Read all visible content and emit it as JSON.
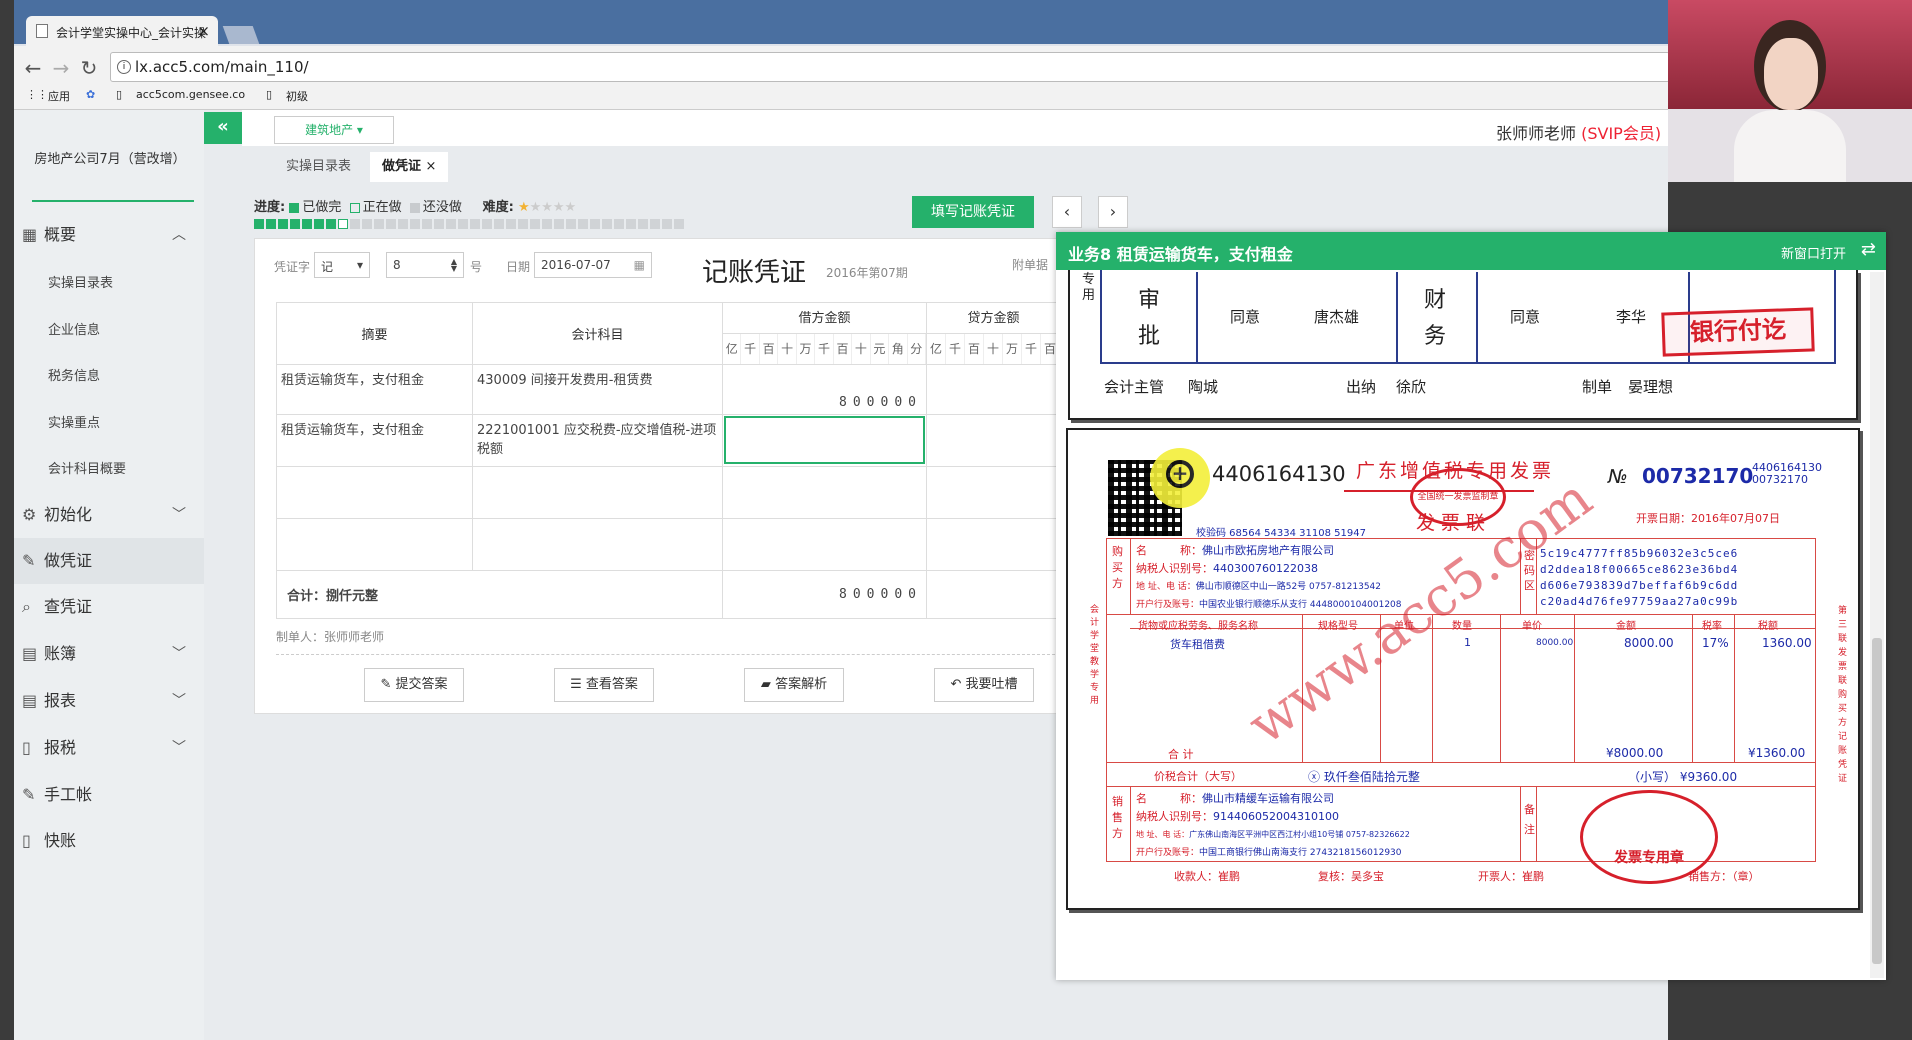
{
  "browser": {
    "tab_title": "会计学堂实操中心_会计实操",
    "url": "lx.acc5.com/main_110/",
    "bookmarks": [
      "应用",
      "acc5com.gensee.co",
      "初级"
    ]
  },
  "header": {
    "collapse_icon": "«",
    "category": "建筑地产",
    "teacher": "张师师老师",
    "vip": "(SVIP会员)"
  },
  "sidebar": {
    "org": "房地产公司7月（营改增）",
    "items": [
      {
        "label": "概要",
        "icon": "grid-icon",
        "expanded": true
      },
      {
        "label": "初始化",
        "icon": "gear-icon"
      },
      {
        "label": "做凭证",
        "icon": "pen-icon",
        "active": true
      },
      {
        "label": "查凭证",
        "icon": "search-icon"
      },
      {
        "label": "账簿",
        "icon": "book-icon"
      },
      {
        "label": "报表",
        "icon": "report-icon"
      },
      {
        "label": "报税",
        "icon": "file-icon"
      },
      {
        "label": "手工帐",
        "icon": "pen-icon"
      },
      {
        "label": "快账",
        "icon": "file-icon"
      }
    ],
    "subitems": [
      "实操目录表",
      "企业信息",
      "税务信息",
      "实操重点",
      "会计科目概要"
    ]
  },
  "tabs": [
    {
      "label": "实操目录表"
    },
    {
      "label": "做凭证"
    }
  ],
  "progress": {
    "label": "进度:",
    "done": "已做完",
    "doing": "正在做",
    "todo": "还没做",
    "difficulty": "难度:",
    "done_count": 8,
    "total": 36
  },
  "actions": {
    "fill": "填写记账凭证",
    "prev": "‹",
    "next": "›"
  },
  "voucher": {
    "word_label": "凭证字",
    "word": "记",
    "num": "8",
    "num_suffix": "号",
    "date_label": "日期",
    "date": "2016-07-07",
    "title": "记账凭证",
    "period": "2016年第07期",
    "attach": "附单据",
    "col_summary": "摘要",
    "col_account": "会计科目",
    "col_debit": "借方金额",
    "col_credit": "贷方金额",
    "units_debit": [
      "亿",
      "千",
      "百",
      "十",
      "万",
      "千",
      "百",
      "十",
      "元",
      "角",
      "分"
    ],
    "units_credit": [
      "亿",
      "千",
      "百",
      "十",
      "万",
      "千",
      "百"
    ],
    "rows": [
      {
        "summary": "租赁运输货车，支付租金",
        "account": "430009 间接开发费用-租赁费",
        "debit": "800000"
      },
      {
        "summary": "租赁运输货车，支付租金",
        "account": "2221001001 应交税费-应交增值税-进项税额",
        "debit": ""
      }
    ],
    "total_label": "合计：捌仟元整",
    "total_debit": "800000",
    "maker": "制单人：张师师老师"
  },
  "buttons": {
    "submit": "提交答案",
    "view": "查看答案",
    "explain": "答案解析",
    "feedback": "我要吐槽"
  },
  "panel": {
    "title": "业务8 租赁运输货车，支付租金",
    "newwin": "新窗口打开",
    "approval": {
      "special": "专用",
      "shen": "审",
      "pi": "批",
      "agree1": "同意",
      "name1": "唐杰雄",
      "cai": "财",
      "wu": "务",
      "agree2": "同意",
      "name2": "李华",
      "stamp": "银行付讫",
      "supervisor_l": "会计主管",
      "supervisor": "陶城",
      "cashier_l": "出纳",
      "cashier": "徐欣",
      "maker_l": "制单",
      "maker": "晏理想"
    },
    "invoice": {
      "code": "4406164130",
      "title": "广东增值税专用发票",
      "sub": "发票联",
      "no_label": "№",
      "no": "00732170",
      "code_small1": "4406164130",
      "code_small2": "00732170",
      "date": "开票日期：2016年07月07日",
      "check": "校验码 68564 54334 31108 51947",
      "buyer": {
        "name": "佛山市欧拓房地产有限公司",
        "taxid": "440300760122038",
        "addr": "佛山市顺德区中山一路52号 0757-81213542",
        "bank": "中国农业银行顺德乐从支行 4448000104001208"
      },
      "cipher": [
        "5c19c4777ff85b96032e3c5ce6",
        "d2ddea18f00665ce8623e36bd4",
        "d606e793839d7beffaf6b9c6dd",
        "c20ad4d76fe97759aa27a0c99b"
      ],
      "col_item": "货物或应税劳务、服务名称",
      "col_spec": "规格型号",
      "col_unit": "单位",
      "col_qty": "数量",
      "col_price": "单价",
      "col_amount": "金额",
      "col_rate": "税率",
      "col_tax": "税额",
      "item": "货车租借费",
      "qty": "1",
      "price": "8000.00",
      "amount": "8000.00",
      "rate": "17%",
      "tax": "1360.00",
      "sum_label": "合   计",
      "sum_amount": "¥8000.00",
      "sum_tax": "¥1360.00",
      "total_cn_label": "价税合计（大写）",
      "total_cn": "ⓧ 玖仟叁佰陆拾元整",
      "total_small": "（小写） ¥9360.00",
      "seller": {
        "name": "佛山市精缓车运输有限公司",
        "taxid": "914406052004310100",
        "addr": "广东佛山南海区平洲中区西江村小组10号铺 0757-82326622",
        "bank": "中国工商银行佛山南海支行 2743218156012930"
      },
      "payee": "收款人：崔鹏",
      "reviewer": "复核：吴多宝",
      "issuer": "开票人：崔鹏",
      "seller_seal_label": "销售方：（章）",
      "side_left": "会计学堂教学专用",
      "side_right": "第三联 发票联 购买方记账凭证",
      "watermark": "www.acc5.com",
      "seal_text": "发票专用章"
    }
  },
  "colors": {
    "accent": "#25b16b",
    "red": "#d6202b",
    "blue": "#1c2aa8"
  }
}
